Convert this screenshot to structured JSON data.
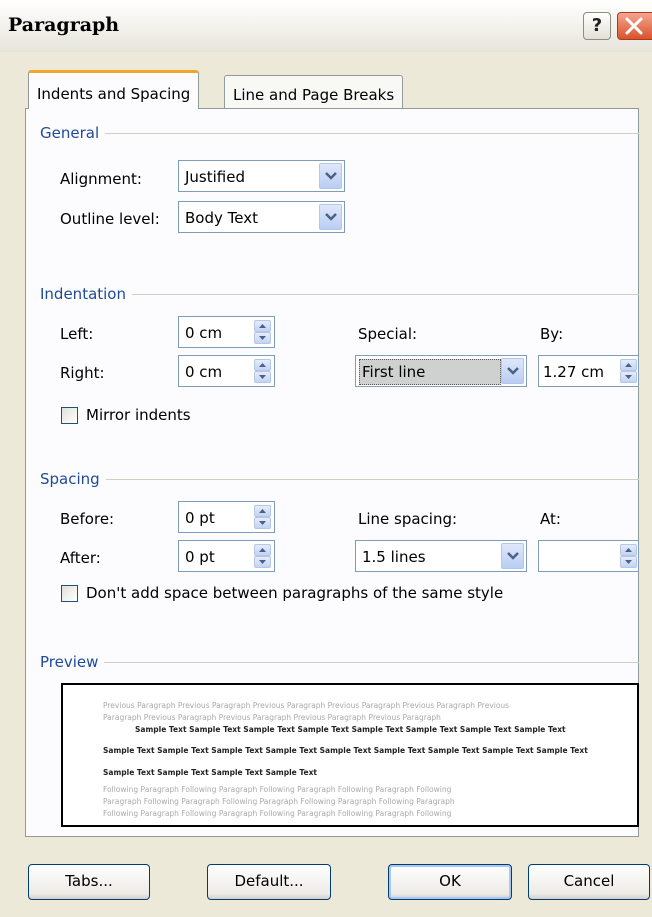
{
  "window": {
    "title": "Paragraph",
    "help_glyph": "?"
  },
  "tabs": [
    {
      "label": "Indents and Spacing",
      "active": true
    },
    {
      "label": "Line and Page Breaks",
      "active": false
    }
  ],
  "general": {
    "header": "General",
    "alignment_label": "Alignment:",
    "alignment_value": "Justified",
    "outline_label": "Outline level:",
    "outline_value": "Body Text"
  },
  "indentation": {
    "header": "Indentation",
    "left_label": "Left:",
    "left_value": "0 cm",
    "right_label": "Right:",
    "right_value": "0 cm",
    "special_label": "Special:",
    "special_value": "First line",
    "by_label": "By:",
    "by_value": "1.27 cm",
    "mirror_label": "Mirror indents"
  },
  "spacing": {
    "header": "Spacing",
    "before_label": "Before:",
    "before_value": "0 pt",
    "after_label": "After:",
    "after_value": "0 pt",
    "line_spacing_label": "Line spacing:",
    "line_spacing_value": "1.5 lines",
    "at_label": "At:",
    "at_value": "",
    "dont_add_label": "Don't add space between paragraphs of the same style"
  },
  "preview": {
    "header": "Preview",
    "prev_line1": "Previous Paragraph Previous Paragraph Previous Paragraph Previous Paragraph Previous Paragraph Previous",
    "prev_line2": "Paragraph Previous Paragraph Previous Paragraph Previous Paragraph Previous Paragraph",
    "sample_line1": "Sample Text Sample Text Sample Text Sample Text Sample Text Sample Text Sample Text Sample Text",
    "sample_line2": "Sample Text Sample Text Sample Text Sample Text Sample Text Sample Text Sample Text Sample Text Sample Text",
    "sample_line3": "Sample Text Sample Text Sample Text Sample Text",
    "follow_line1": "Following Paragraph Following Paragraph Following Paragraph Following Paragraph Following",
    "follow_line2": "Paragraph Following Paragraph Following Paragraph Following Paragraph Following Paragraph",
    "follow_line3": "Following Paragraph Following Paragraph Following Paragraph Following Paragraph Following"
  },
  "buttons": {
    "tabs": "Tabs...",
    "default": "Default...",
    "ok": "OK",
    "cancel": "Cancel"
  },
  "colors": {
    "group_header": "#1f4a99",
    "active_tab_accent": "#f2a62b",
    "close_button": "#d9532c"
  }
}
